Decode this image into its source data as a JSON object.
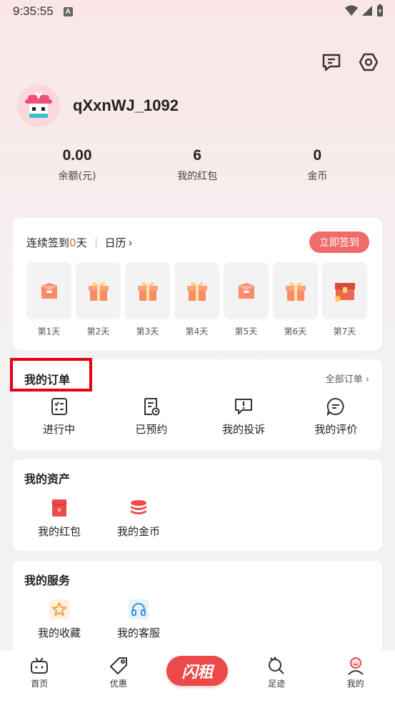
{
  "status_bar": {
    "time": "9:35:55",
    "badge": "A"
  },
  "header": {
    "message_icon": "message-icon",
    "settings_icon": "hexagon-settings-icon"
  },
  "profile": {
    "username": "qXxnWJ_1092"
  },
  "stats": [
    {
      "value": "0.00",
      "label": "余额(元)"
    },
    {
      "value": "6",
      "label": "我的红包"
    },
    {
      "value": "0",
      "label": "金币"
    }
  ],
  "checkin": {
    "prefix": "连续签到",
    "days": "0",
    "suffix": "天",
    "calendar": "日历",
    "chevron": "›",
    "button": "立即签到",
    "days_list": [
      "第1天",
      "第2天",
      "第3天",
      "第4天",
      "第5天",
      "第6天",
      "第7天"
    ],
    "reward_icons": [
      "red-envelope-icon",
      "gift-box-icon",
      "gift-box-icon",
      "gift-box-icon",
      "red-envelope-icon",
      "gift-box-icon",
      "treasure-chest-icon"
    ]
  },
  "orders": {
    "title": "我的订单",
    "all_link": "全部订单 ›",
    "items": [
      "进行中",
      "已预约",
      "我的投诉",
      "我的评价"
    ]
  },
  "assets": {
    "title": "我的资产",
    "items": [
      "我的红包",
      "我的金币"
    ]
  },
  "services": {
    "title": "我的服务",
    "items": [
      "我的收藏",
      "我的客服"
    ]
  },
  "tabbar": {
    "items": [
      "首页",
      "优惠",
      "足迹",
      "我的"
    ],
    "center": "闪租"
  },
  "colors": {
    "accent": "#f06b6b",
    "highlight": "#e60012",
    "orange": "#f0622d"
  }
}
